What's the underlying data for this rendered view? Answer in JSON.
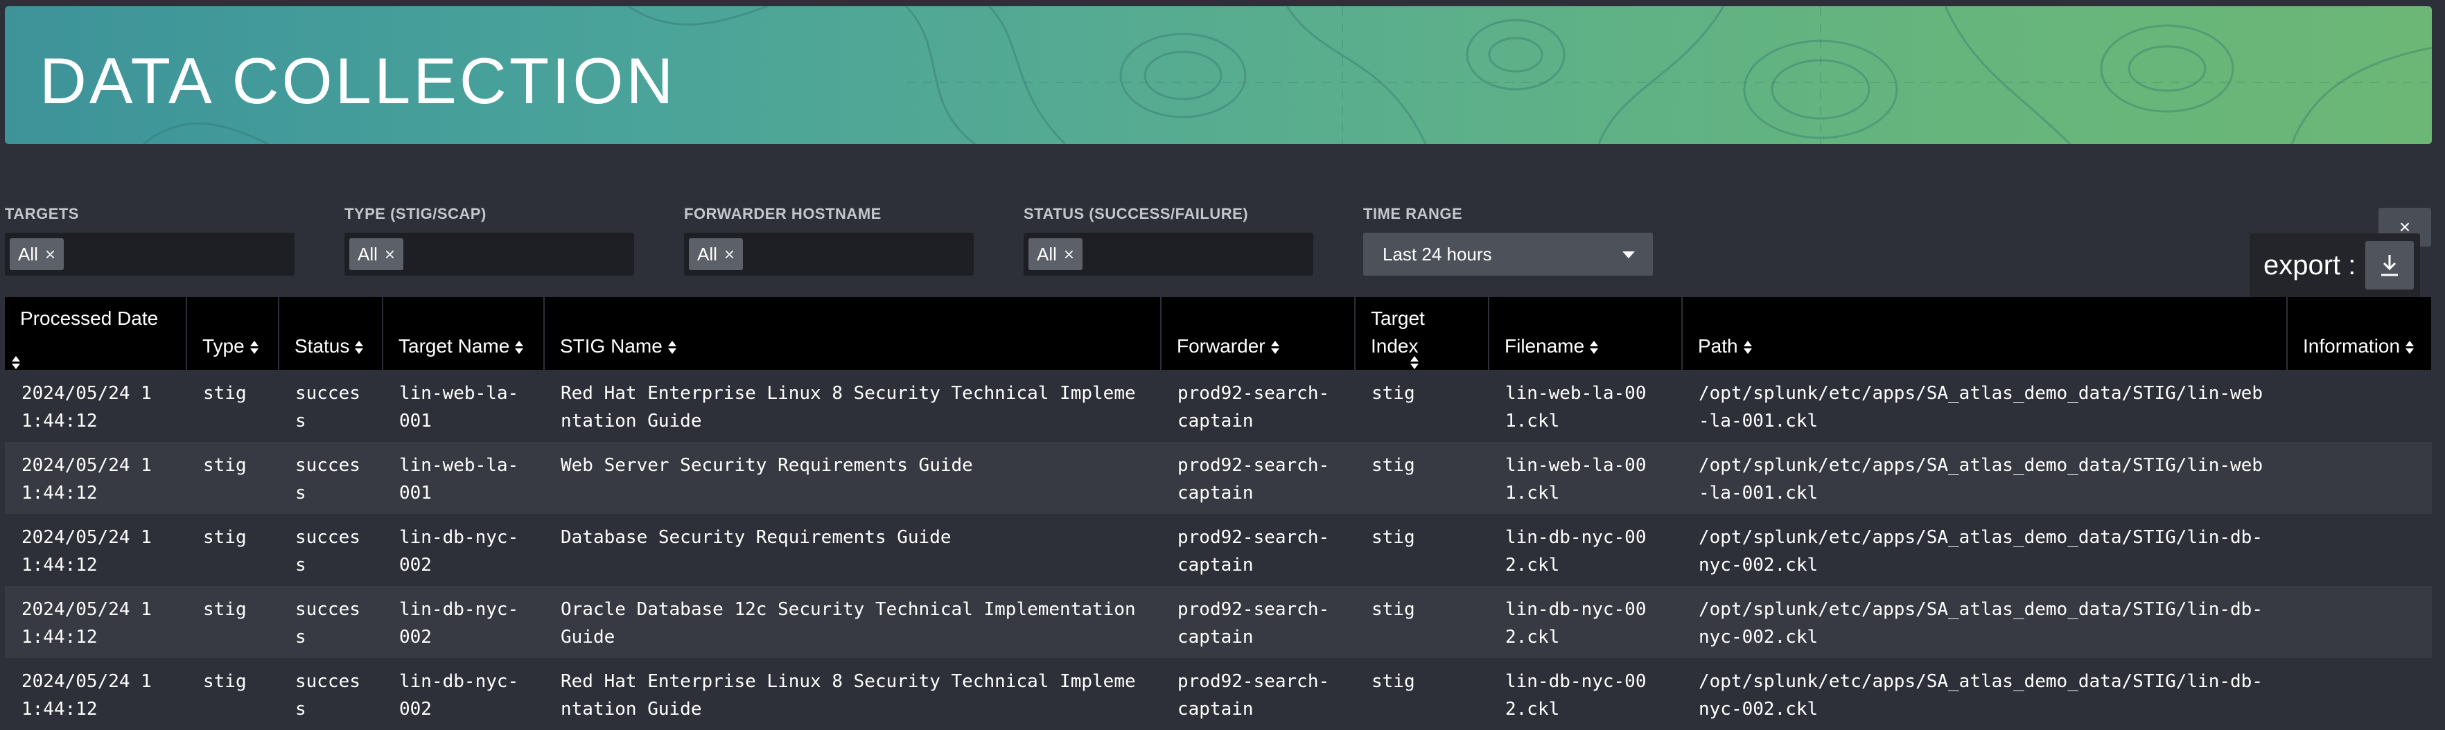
{
  "banner": {
    "title": "DATA COLLECTION"
  },
  "filters": [
    {
      "label": "TARGETS",
      "value": "All",
      "remove": "×"
    },
    {
      "label": "TYPE (STIG/SCAP)",
      "value": "All",
      "remove": "×"
    },
    {
      "label": "FORWARDER HOSTNAME",
      "value": "All",
      "remove": "×"
    },
    {
      "label": "STATUS (SUCCESS/FAILURE)",
      "value": "All",
      "remove": "×"
    }
  ],
  "time_range": {
    "label": "TIME RANGE",
    "value": "Last 24 hours"
  },
  "close_label": "×",
  "export": {
    "label": "export :",
    "icon": "download-icon"
  },
  "table": {
    "columns": [
      "Processed Date",
      "Type",
      "Status",
      "Target Name",
      "STIG Name",
      "Forwarder",
      "Target Index",
      "Filename",
      "Path",
      "Information"
    ],
    "rows": [
      [
        "2024/05/24 11:44:12",
        "stig",
        "success",
        "lin-web-la-001",
        "Red Hat Enterprise Linux 8 Security Technical Implementation Guide",
        "prod92-search-captain",
        "stig",
        "lin-web-la-001.ckl",
        "/opt/splunk/etc/apps/SA_atlas_demo_data/STIG/lin-web-la-001.ckl",
        ""
      ],
      [
        "2024/05/24 11:44:12",
        "stig",
        "success",
        "lin-web-la-001",
        "Web Server Security Requirements Guide",
        "prod92-search-captain",
        "stig",
        "lin-web-la-001.ckl",
        "/opt/splunk/etc/apps/SA_atlas_demo_data/STIG/lin-web-la-001.ckl",
        ""
      ],
      [
        "2024/05/24 11:44:12",
        "stig",
        "success",
        "lin-db-nyc-002",
        "Database Security Requirements Guide",
        "prod92-search-captain",
        "stig",
        "lin-db-nyc-002.ckl",
        "/opt/splunk/etc/apps/SA_atlas_demo_data/STIG/lin-db-nyc-002.ckl",
        ""
      ],
      [
        "2024/05/24 11:44:12",
        "stig",
        "success",
        "lin-db-nyc-002",
        "Oracle Database 12c Security Technical Implementation Guide",
        "prod92-search-captain",
        "stig",
        "lin-db-nyc-002.ckl",
        "/opt/splunk/etc/apps/SA_atlas_demo_data/STIG/lin-db-nyc-002.ckl",
        ""
      ],
      [
        "2024/05/24 11:44:12",
        "stig",
        "success",
        "lin-db-nyc-002",
        "Red Hat Enterprise Linux 8 Security Technical Implementation Guide",
        "prod92-search-captain",
        "stig",
        "lin-db-nyc-002.ckl",
        "/opt/splunk/etc/apps/SA_atlas_demo_data/STIG/lin-db-nyc-002.ckl",
        ""
      ]
    ]
  },
  "colors": {
    "background": "#2d3038",
    "header_bg": "#000000",
    "banner_start": "#3d9399",
    "banner_end": "#6cb776"
  }
}
